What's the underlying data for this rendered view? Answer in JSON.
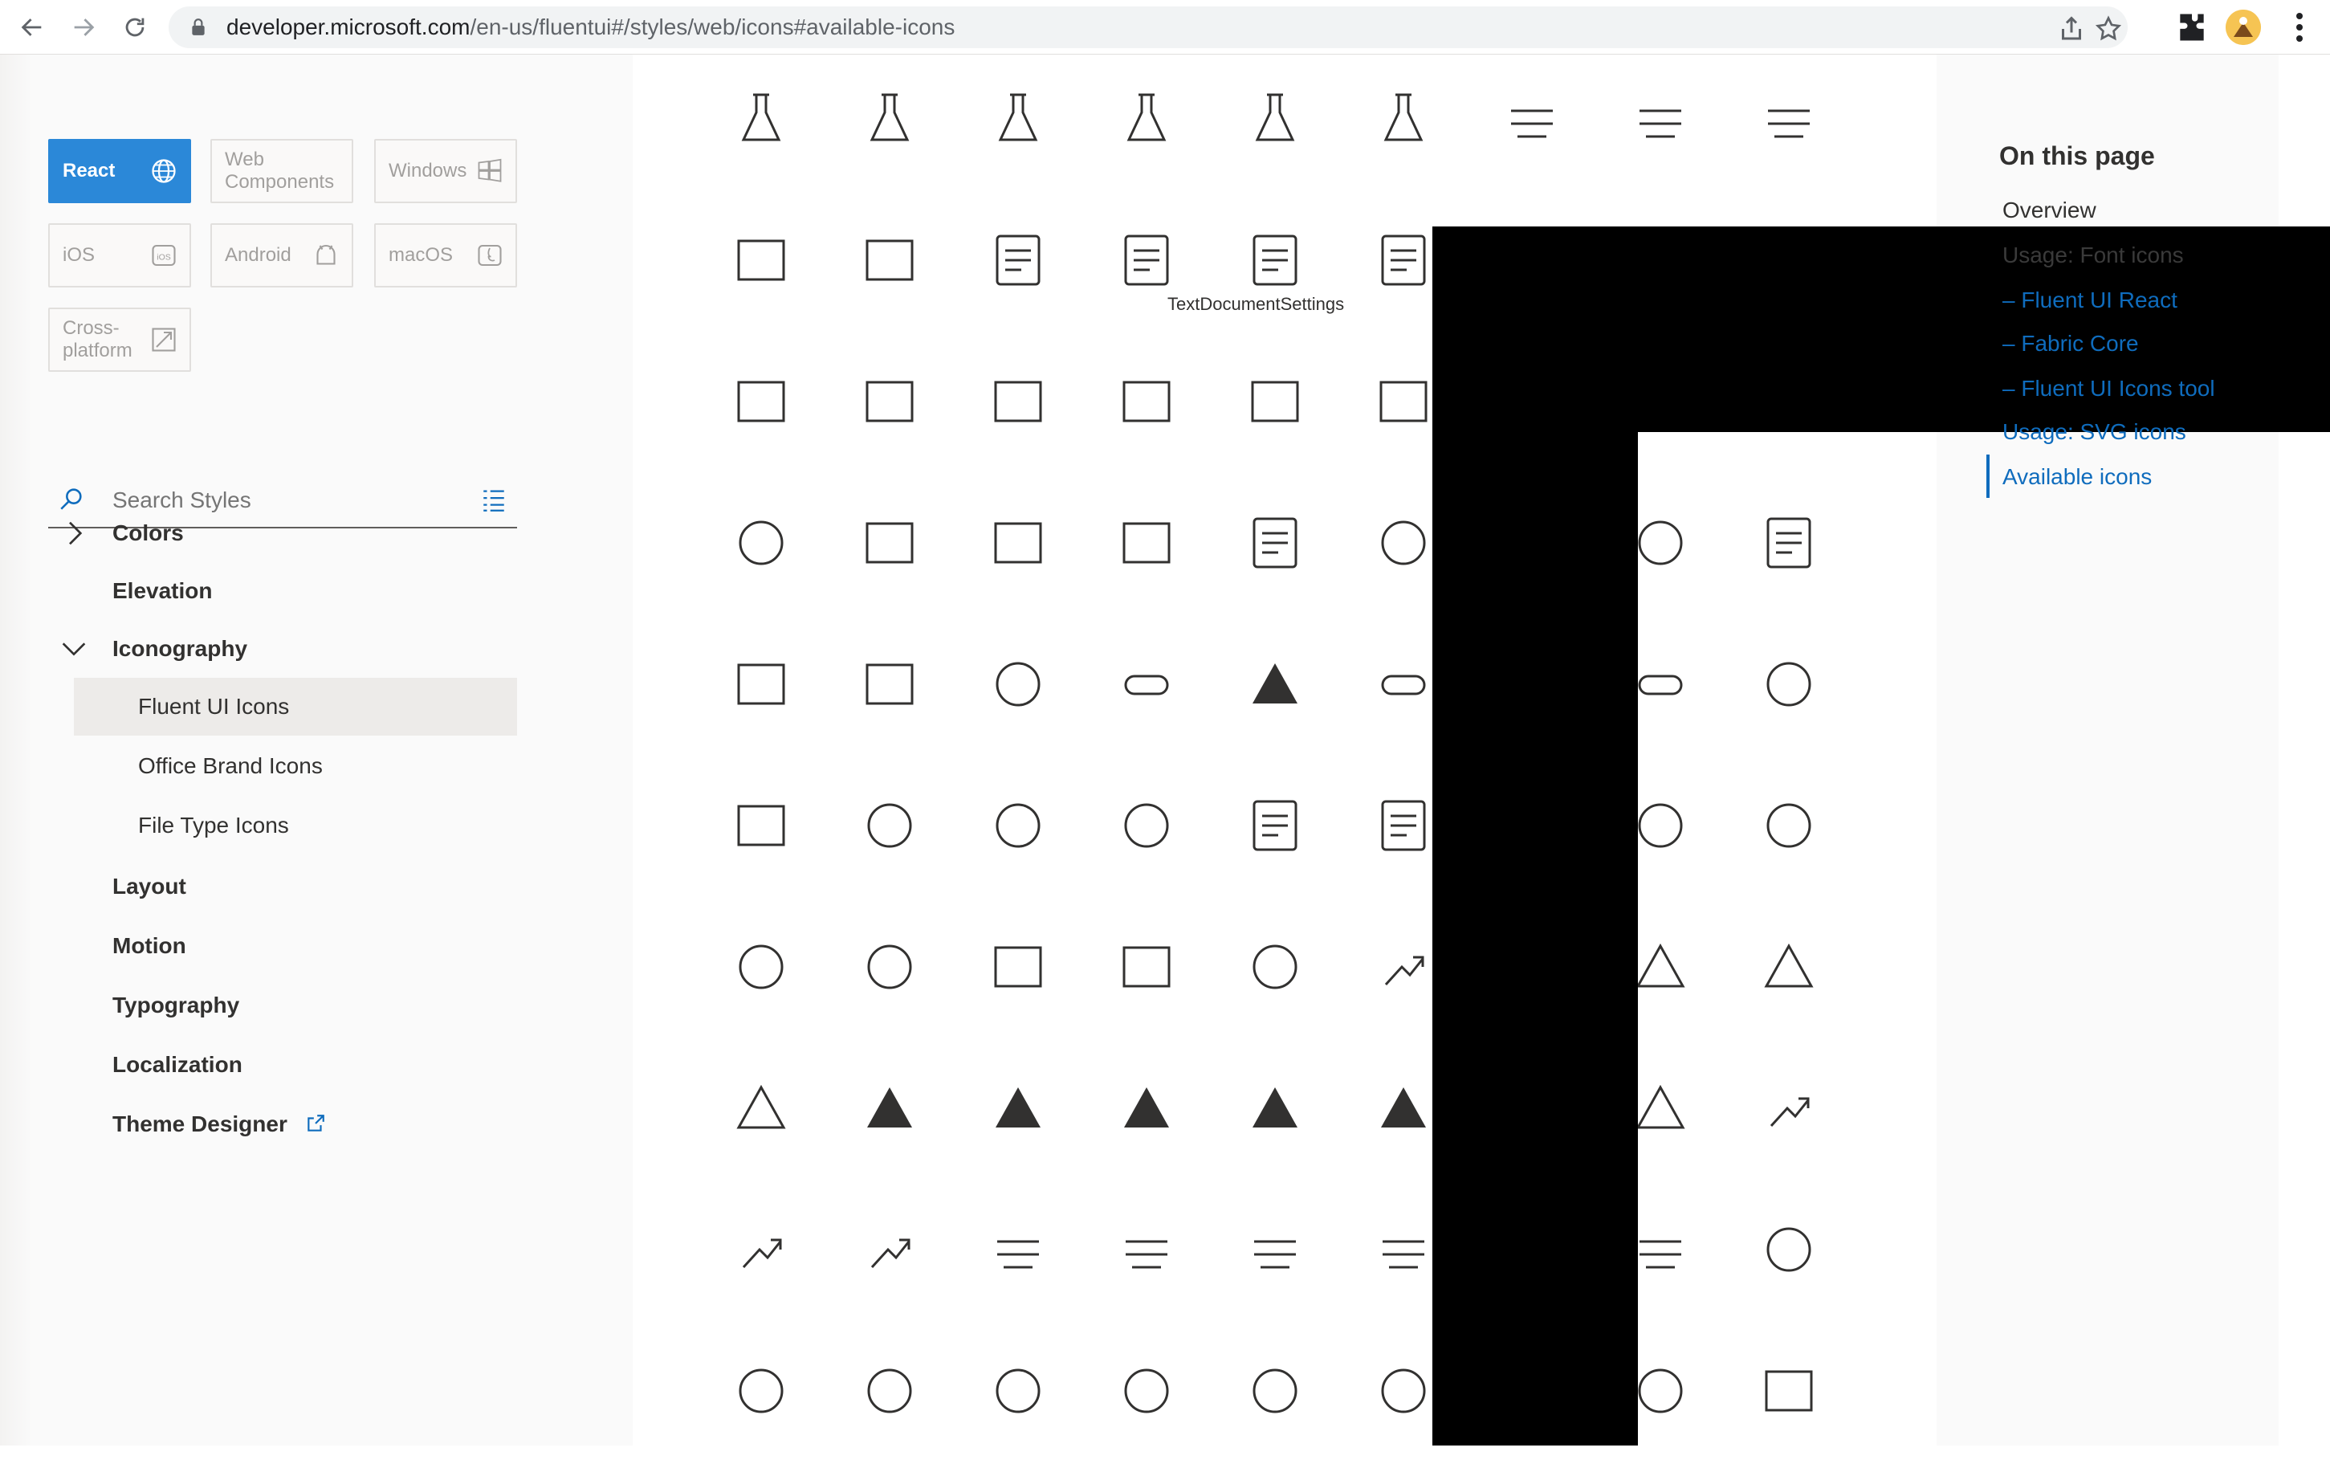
{
  "browser": {
    "url_host": "developer.microsoft.com",
    "url_path": "/en-us/fluentui#/styles/web/icons#available-icons"
  },
  "platforms": [
    {
      "label": "React",
      "active": true,
      "icon": "globe-icon"
    },
    {
      "label": "Web Components",
      "active": false,
      "icon": "none"
    },
    {
      "label": "Windows",
      "active": false,
      "icon": "windows-icon"
    },
    {
      "label": "iOS",
      "active": false,
      "icon": "ios-icon"
    },
    {
      "label": "Android",
      "active": false,
      "icon": "android-icon"
    },
    {
      "label": "macOS",
      "active": false,
      "icon": "macos-icon"
    },
    {
      "label": "Cross-platform",
      "active": false,
      "icon": "cross-platform-icon"
    }
  ],
  "search": {
    "placeholder": "Search Styles"
  },
  "nav": {
    "colors": "Colors",
    "elevation": "Elevation",
    "iconography": "Iconography",
    "fluent_ui_icons": "Fluent UI Icons",
    "office_brand_icons": "Office Brand Icons",
    "file_type_icons": "File Type Icons",
    "layout": "Layout",
    "motion": "Motion",
    "typography": "Typography",
    "localization": "Localization",
    "theme_designer": "Theme Designer"
  },
  "tooltip": "TextDocumentSettings",
  "on_this_page": {
    "title": "On this page",
    "overview": "Overview",
    "usage_font_icons": "Usage: Font icons",
    "fluent_ui_react": "– Fluent UI React",
    "fabric_core": "– Fabric Core",
    "fluent_ui_icons_tool": "– Fluent UI Icons tool",
    "usage_svg_icons": "Usage: SVG icons",
    "available_icons": "Available icons"
  },
  "icon_grid": [
    [
      "test-beaker-icon",
      "test-beaker-at-icon",
      "test-document-icon",
      "test-step-icon",
      "test-folder-icon",
      "test-user-icon",
      "text-align-bottom-icon",
      "text-align-center-icon",
      "text-align-top-icon"
    ],
    [
      "text-box-icon",
      "text-field-icon",
      "text-document-edit-icon",
      "text-document-icon",
      "text-document-settings-icon",
      "text-document-user-icon",
      "text-callout-icon",
      "text-overflow-icon",
      "text-paragraph-option-icon"
    ],
    [
      "text-recognition-icon",
      "text-rotate-up-icon",
      "text-rotate-down-icon",
      "text-rotate-right-icon",
      "text-rotation-icon",
      "thin-client-icon",
      "third-quarter-circle-icon",
      "thumbnail-view-icon",
      "thumbnail-view-mirrored-icon"
    ],
    [
      "thunderstorm-icon",
      "ticket-icon",
      "tiles-icon",
      "tiles-2-icon",
      "timeline-icon",
      "timer-display-icon",
      "time-entry-icon",
      "time-picker-icon",
      "timeline-delivery-icon"
    ],
    [
      "table-icon",
      "tiles-mosaic-icon",
      "timer-icon",
      "toggle-border-icon",
      "toggle-filled-icon",
      "toggle-left-icon",
      "toggle-right-icon",
      "toggle-thumb-icon",
      "toll-icon"
    ],
    [
      "toolbox-icon",
      "sum-icon",
      "touch-icon",
      "touch-pointer-icon",
      "task-list-icon",
      "task-list-check-icon",
      "train-icon",
      "train-solid-icon",
      "transfer-call-icon"
    ],
    [
      "resize-vertical-icon",
      "people-sync-icon",
      "fit-width-icon",
      "narrow-width-icon",
      "translate-icon",
      "trending-up-icon",
      "triangle-down-icon",
      "triangle-left-icon",
      "triangle-right-icon"
    ],
    [
      "triangle-up-icon",
      "triangle-solid-up-icon",
      "triangle-solid-down-icon",
      "triangle-solid-up-2-icon",
      "triangle-solid-left-icon",
      "triangle-solid-right-icon",
      "triangle-shape-solid-icon",
      "triangle-shape-icon",
      "trigger-approval-icon"
    ],
    [
      "trigger-auto-icon",
      "trigger-user-icon",
      "trim-end-icon",
      "trim-icon",
      "trim-start-icon",
      "triple-column-edit-icon",
      "triple-column-icon",
      "triple-column-wide-icon",
      "trophy-icon"
    ],
    [
      "trophy-filled-icon",
      "trophy-2-icon",
      "turn-right-icon",
      "badge-burst-icon",
      "twitter-logo-icon",
      "unlink-icon",
      "usb-icon",
      "umbrella-icon",
      "unknown-image-icon"
    ]
  ]
}
